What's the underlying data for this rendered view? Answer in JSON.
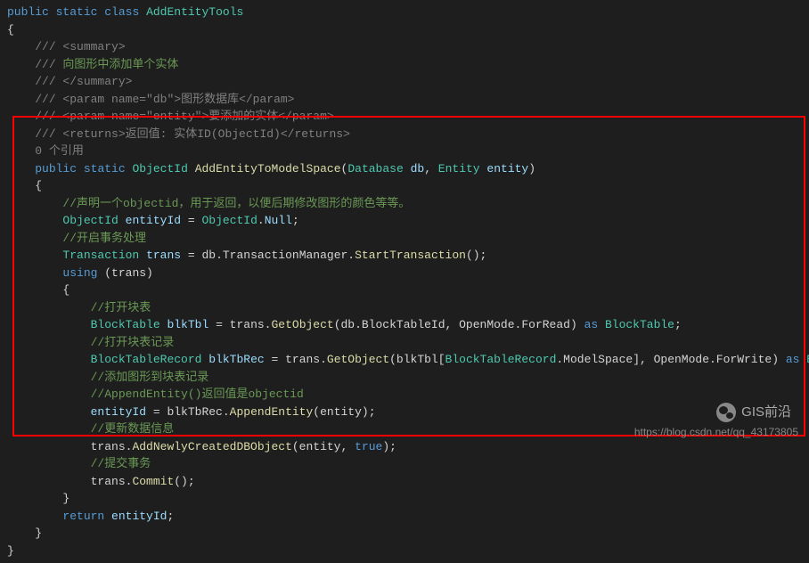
{
  "code": {
    "l1": {
      "kw1": "public",
      "kw2": "static",
      "kw3": "class",
      "name": "AddEntityTools"
    },
    "l2": "{",
    "l3_slash": "///",
    "l3_open": " <summary>",
    "l4_slash": "///",
    "l4_txt": " 向图形中添加单个实体",
    "l5_slash": "///",
    "l5_close": " </summary>",
    "l6_slash": "///",
    "l6_p1": " <param name=",
    "l6_q": "\"db\"",
    "l6_p2": ">图形数据库</param>",
    "l7_slash": "///",
    "l7_p1": " <param name=",
    "l7_q": "\"entity\"",
    "l7_p2": ">要添加的实体</param>",
    "l8_slash": "///",
    "l8_r": " <returns>返回值: 实体ID(ObjectId)</returns>",
    "l9": "0 个引用",
    "l10": {
      "kw1": "public",
      "kw2": "static",
      "type": "ObjectId",
      "method": "AddEntityToModelSpace",
      "p1t": "Database",
      "p1n": "db",
      "p2t": "Entity",
      "p2n": "entity"
    },
    "l11": "{",
    "l12": "//声明一个objectid，用于返回，以便后期修改图形的颜色等等。",
    "l13": {
      "type": "ObjectId",
      "var": "entityId",
      "eq": " = ",
      "cls": "ObjectId",
      "dot": ".",
      "prop": "Null",
      "end": ";"
    },
    "l14": "//开启事务处理",
    "l15": {
      "type": "Transaction",
      "var": "trans",
      "eq": " = db.TransactionManager.",
      "method": "StartTransaction",
      "end": "();"
    },
    "l16": {
      "kw": "using",
      "txt": " (trans)"
    },
    "l17": "{",
    "l18": "//打开块表",
    "l19": {
      "type": "BlockTable",
      "var": "blkTbl",
      "txt1": " = trans.",
      "m1": "GetObject",
      "txt2": "(db.BlockTableId, OpenMode.ForRead) ",
      "kw": "as",
      "type2": " BlockTable",
      "end": ";"
    },
    "l20": "//打开块表记录",
    "l21": {
      "type": "BlockTableRecord",
      "var": "blkTbRec",
      "txt1": " = trans.",
      "m1": "GetObject",
      "txt2": "(blkTbl[",
      "cls": "BlockTableRecord",
      "txt3": ".ModelSpace], OpenMode.ForWrite) ",
      "kw": "as",
      "type2": " BlockTableRecord",
      "end": ";"
    },
    "l22": "//添加图形到块表记录",
    "l23": "//AppendEntity()返回值是objectid",
    "l24": {
      "var": "entityId",
      "txt": " = blkTbRec.",
      "m": "AppendEntity",
      "end": "(entity);"
    },
    "l25": "//更新数据信息",
    "l26": {
      "txt1": "trans.",
      "m": "AddNewlyCreatedDBObject",
      "txt2": "(entity, ",
      "kw": "true",
      "end": ");"
    },
    "l27": "//提交事务",
    "l28": {
      "txt1": "trans.",
      "m": "Commit",
      "end": "();"
    },
    "l29": "}",
    "l30": {
      "kw": "return",
      "var": " entityId",
      "end": ";"
    },
    "l31": "}",
    "l32": "}"
  },
  "watermark": "https://blog.csdn.net/qq_43173805",
  "wechat_label": "GIS前沿"
}
